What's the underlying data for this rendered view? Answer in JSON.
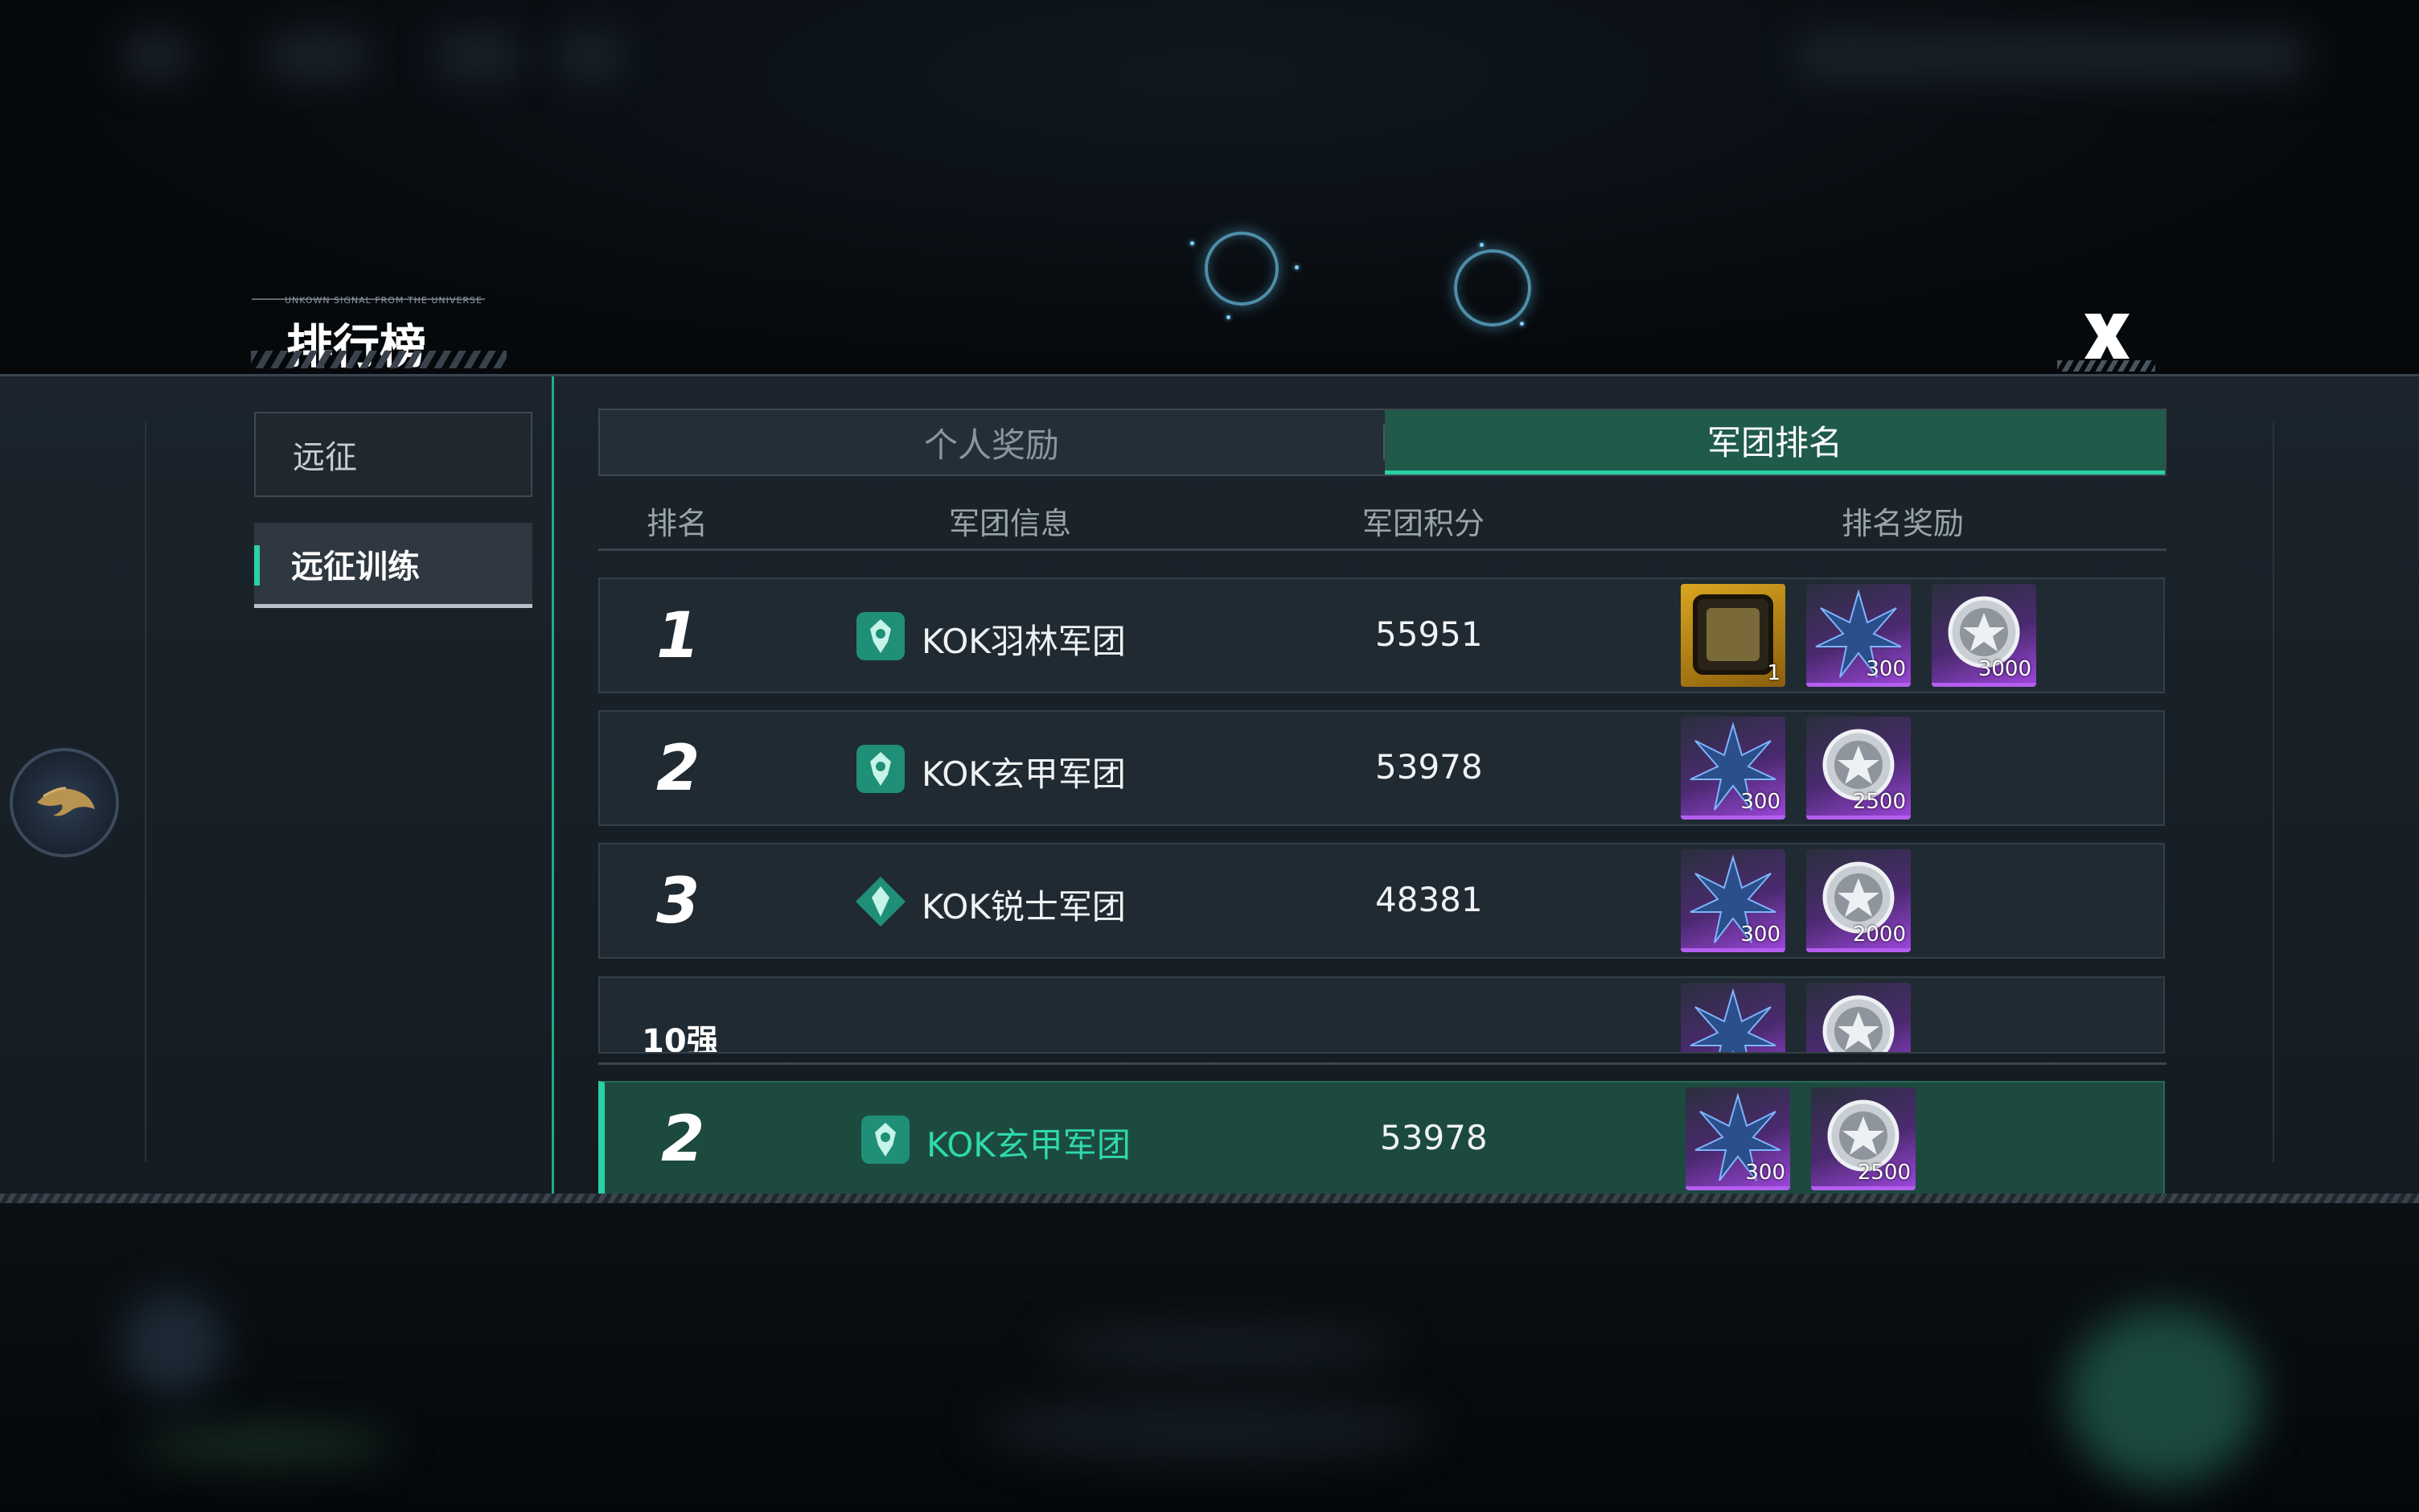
{
  "header": {
    "title": "排行榜",
    "tagline": "UNKOWN SIGNAL FROM THE UNIVERSE"
  },
  "sidebar": {
    "items": [
      {
        "label": "远征",
        "active": false
      },
      {
        "label": "远征训练",
        "active": true
      }
    ]
  },
  "tabs": [
    {
      "label": "个人奖励",
      "active": false
    },
    {
      "label": "军团排名",
      "active": true
    }
  ],
  "columns": [
    "排名",
    "军团信息",
    "军团积分",
    "排名奖励"
  ],
  "rows": [
    {
      "rank": "1",
      "name": "KOK羽林军团",
      "score": "55951",
      "rewards": [
        {
          "icon": "frame-icon",
          "qty": "1"
        },
        {
          "icon": "crystal-icon",
          "qty": "300"
        },
        {
          "icon": "silver-coin-icon",
          "qty": "3000"
        }
      ]
    },
    {
      "rank": "2",
      "name": "KOK玄甲军团",
      "score": "53978",
      "rewards": [
        {
          "icon": "crystal-icon",
          "qty": "300"
        },
        {
          "icon": "silver-coin-icon",
          "qty": "2500"
        }
      ]
    },
    {
      "rank": "3",
      "name": "KOK锐士军团",
      "score": "48381",
      "rewards": [
        {
          "icon": "crystal-icon",
          "qty": "300"
        },
        {
          "icon": "silver-coin-icon",
          "qty": "2000"
        }
      ]
    },
    {
      "rank": "10强",
      "name": "",
      "score": "",
      "rewards": [
        {
          "icon": "crystal-icon",
          "qty": ""
        },
        {
          "icon": "silver-coin-icon",
          "qty": ""
        }
      ]
    }
  ],
  "my_legion": {
    "rank": "2",
    "name": "KOK玄甲军团",
    "score": "53978",
    "rewards": [
      {
        "icon": "crystal-icon",
        "qty": "300"
      },
      {
        "icon": "silver-coin-icon",
        "qty": "2500"
      }
    ]
  },
  "colors": {
    "accent": "#2bd1a6",
    "active_tab": "#1f5a4a",
    "reward_gold": "#d9a520",
    "reward_purple": "#9a45d8"
  }
}
